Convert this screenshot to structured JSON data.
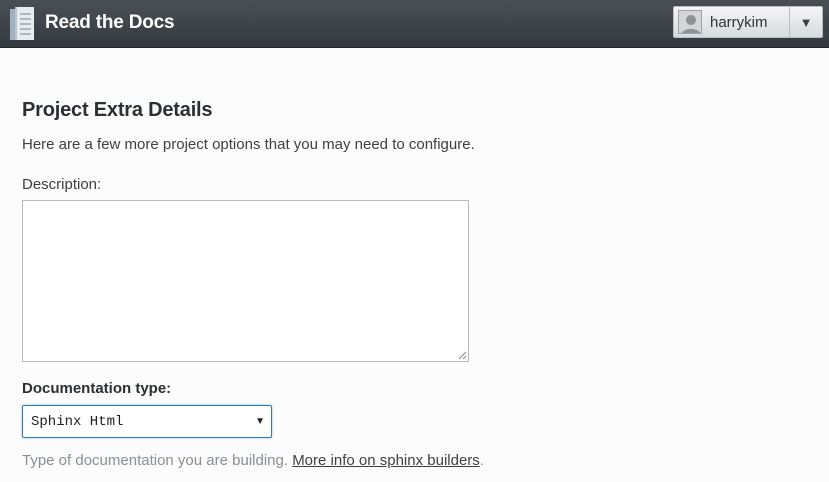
{
  "header": {
    "brand": "Read the Docs",
    "logo_icon": "book-icon",
    "user": {
      "name": "harrykim",
      "avatar_icon": "user-avatar-icon",
      "toggle_icon": "caret-down-icon",
      "toggle_glyph": "▼"
    },
    "colors": {
      "bar": "#343a40",
      "accent": "#2980b9"
    }
  },
  "form": {
    "title": "Project Extra Details",
    "intro": "Here are a few more project options that you may need to configure.",
    "description": {
      "label": "Description:",
      "value": ""
    },
    "doc_type": {
      "label": "Documentation type:",
      "selected": "Sphinx Html",
      "caret": "▼",
      "help_text": "Type of documentation you are building.",
      "help_link": "More info on sphinx builders",
      "help_tail": "."
    }
  }
}
